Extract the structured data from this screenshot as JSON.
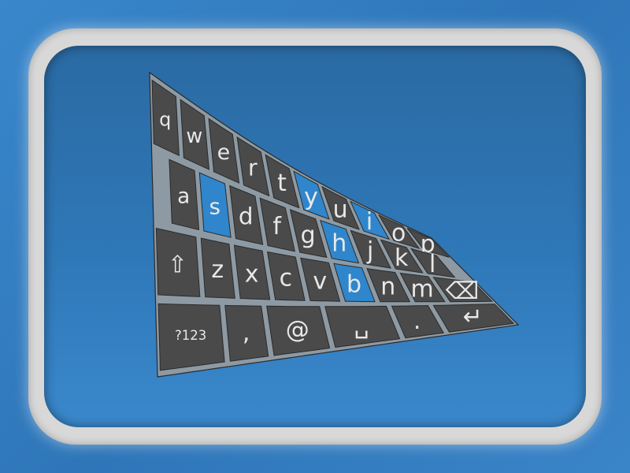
{
  "keyboard": {
    "rows": [
      [
        {
          "label": "q",
          "highlight": false
        },
        {
          "label": "w",
          "highlight": false
        },
        {
          "label": "e",
          "highlight": false
        },
        {
          "label": "r",
          "highlight": false
        },
        {
          "label": "t",
          "highlight": false
        },
        {
          "label": "y",
          "highlight": true
        },
        {
          "label": "u",
          "highlight": false
        },
        {
          "label": "i",
          "highlight": true
        },
        {
          "label": "o",
          "highlight": false
        },
        {
          "label": "p",
          "highlight": false
        }
      ],
      [
        {
          "label": "a",
          "highlight": false
        },
        {
          "label": "s",
          "highlight": true
        },
        {
          "label": "d",
          "highlight": false
        },
        {
          "label": "f",
          "highlight": false
        },
        {
          "label": "g",
          "highlight": false
        },
        {
          "label": "h",
          "highlight": true
        },
        {
          "label": "j",
          "highlight": false
        },
        {
          "label": "k",
          "highlight": false
        },
        {
          "label": "l",
          "highlight": false
        }
      ],
      [
        {
          "label": "⇧",
          "highlight": false,
          "icon": "shift-icon"
        },
        {
          "label": "z",
          "highlight": false
        },
        {
          "label": "x",
          "highlight": false
        },
        {
          "label": "c",
          "highlight": false
        },
        {
          "label": "v",
          "highlight": false
        },
        {
          "label": "b",
          "highlight": true
        },
        {
          "label": "n",
          "highlight": false
        },
        {
          "label": "m",
          "highlight": false
        },
        {
          "label": "⌫",
          "highlight": false,
          "icon": "backspace-icon"
        }
      ],
      [
        {
          "label": "?123",
          "highlight": false
        },
        {
          "label": ",",
          "highlight": false
        },
        {
          "label": "@",
          "highlight": false
        },
        {
          "label": "␣",
          "highlight": false,
          "icon": "space-icon"
        },
        {
          "label": ".",
          "highlight": false
        },
        {
          "label": "↵",
          "highlight": false,
          "icon": "enter-icon"
        }
      ]
    ],
    "colors": {
      "key": "#4a4a4a",
      "key_highlight": "#2f86cc",
      "board": "#8e9aa3",
      "text": "#e8e8e8"
    }
  }
}
